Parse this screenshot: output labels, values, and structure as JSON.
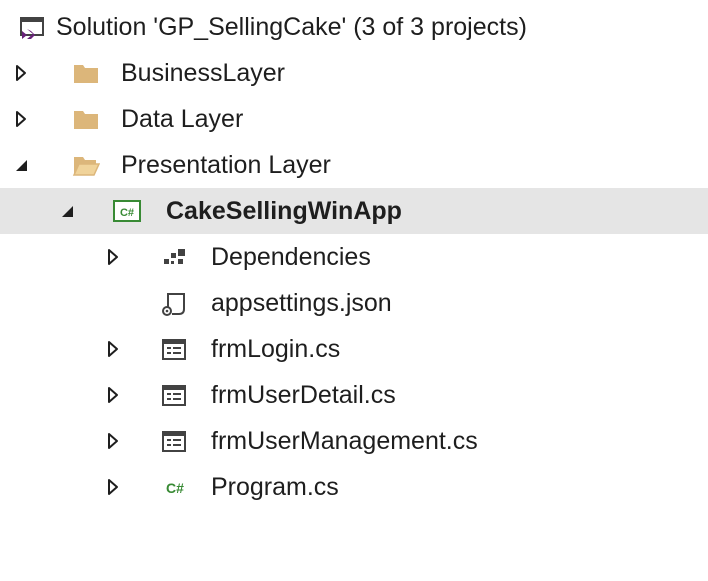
{
  "solution_explorer": {
    "solution": {
      "label": "Solution 'GP_SellingCake' (3 of 3 projects)",
      "icon": "visual-studio-solution-icon"
    },
    "folders": [
      {
        "label": "BusinessLayer",
        "icon": "folder-closed-icon",
        "expanded": false
      },
      {
        "label": "Data Layer",
        "icon": "folder-closed-icon",
        "expanded": false
      },
      {
        "label": "Presentation Layer",
        "icon": "folder-open-icon",
        "expanded": true
      }
    ],
    "project": {
      "label": "CakeSellingWinApp",
      "icon": "csharp-project-icon",
      "badge_text": "C#",
      "expanded": true,
      "selected": true
    },
    "items": [
      {
        "label": "Dependencies",
        "icon": "dependencies-icon",
        "expandable": true
      },
      {
        "label": "appsettings.json",
        "icon": "json-file-icon",
        "expandable": false
      },
      {
        "label": "frmLogin.cs",
        "icon": "windows-form-icon",
        "expandable": true
      },
      {
        "label": "frmUserDetail.cs",
        "icon": "windows-form-icon",
        "expandable": true
      },
      {
        "label": "frmUserManagement.cs",
        "icon": "windows-form-icon",
        "expandable": true
      },
      {
        "label": "Program.cs",
        "icon": "csharp-file-icon",
        "badge_text": "C#",
        "expandable": true
      }
    ],
    "colors": {
      "selection": "#e5e5e5",
      "folder": "#dcb67a",
      "csharp_green": "#388a34",
      "vs_purple": "#68217a",
      "icon_gray": "#424242"
    }
  }
}
